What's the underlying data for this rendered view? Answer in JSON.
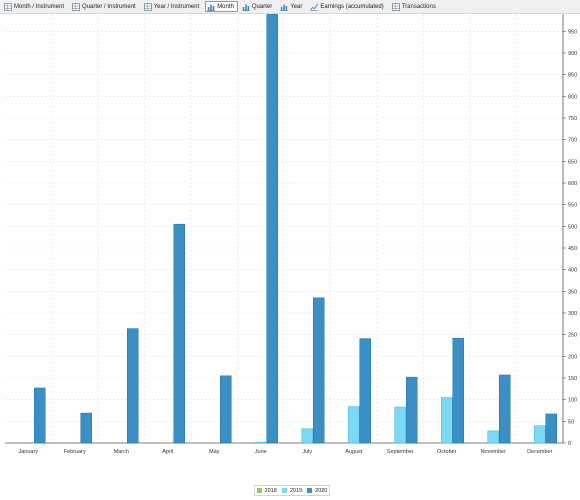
{
  "toolbar": {
    "tabs": [
      {
        "label": "Month / Instrument",
        "icon": "table-icon",
        "active": false
      },
      {
        "label": "Quarter / Instrument",
        "icon": "table-icon",
        "active": false
      },
      {
        "label": "Year / Instrument",
        "icon": "table-icon",
        "active": false
      },
      {
        "label": "Month",
        "icon": "bar-chart-icon",
        "active": true
      },
      {
        "label": "Quarter",
        "icon": "bar-chart-icon",
        "active": false
      },
      {
        "label": "Year",
        "icon": "bar-chart-icon",
        "active": false
      },
      {
        "label": "Earnings (accumulated)",
        "icon": "line-chart-icon",
        "active": false
      },
      {
        "label": "Transactions",
        "icon": "table-icon",
        "active": false
      }
    ]
  },
  "colors": {
    "series_2018": "#8dc96a",
    "series_2019": "#7ad9f5",
    "series_2020": "#3a8fc6",
    "grid": "#e2e2e2"
  },
  "chart_data": {
    "type": "bar",
    "categories": [
      "January",
      "February",
      "March",
      "April",
      "May",
      "June",
      "July",
      "August",
      "September",
      "October",
      "November",
      "December"
    ],
    "series": [
      {
        "name": "2018",
        "values": [
          0,
          0,
          0,
          0,
          0,
          0,
          0,
          0,
          0,
          0,
          0,
          0
        ]
      },
      {
        "name": "2019",
        "values": [
          0,
          0,
          0,
          0,
          0,
          2,
          33,
          84,
          83,
          105,
          28,
          40
        ]
      },
      {
        "name": "2020",
        "values": [
          127,
          69,
          264,
          505,
          155,
          990,
          335,
          241,
          152,
          242,
          157,
          67
        ]
      }
    ],
    "yticks": [
      0,
      50,
      100,
      150,
      200,
      250,
      300,
      350,
      400,
      450,
      500,
      550,
      600,
      650,
      700,
      750,
      800,
      850,
      900,
      950
    ],
    "ylim": [
      0,
      990
    ],
    "ylabel": "",
    "xlabel": "",
    "y_axis_side": "right",
    "grid": true,
    "legend_position": "bottom-center"
  }
}
